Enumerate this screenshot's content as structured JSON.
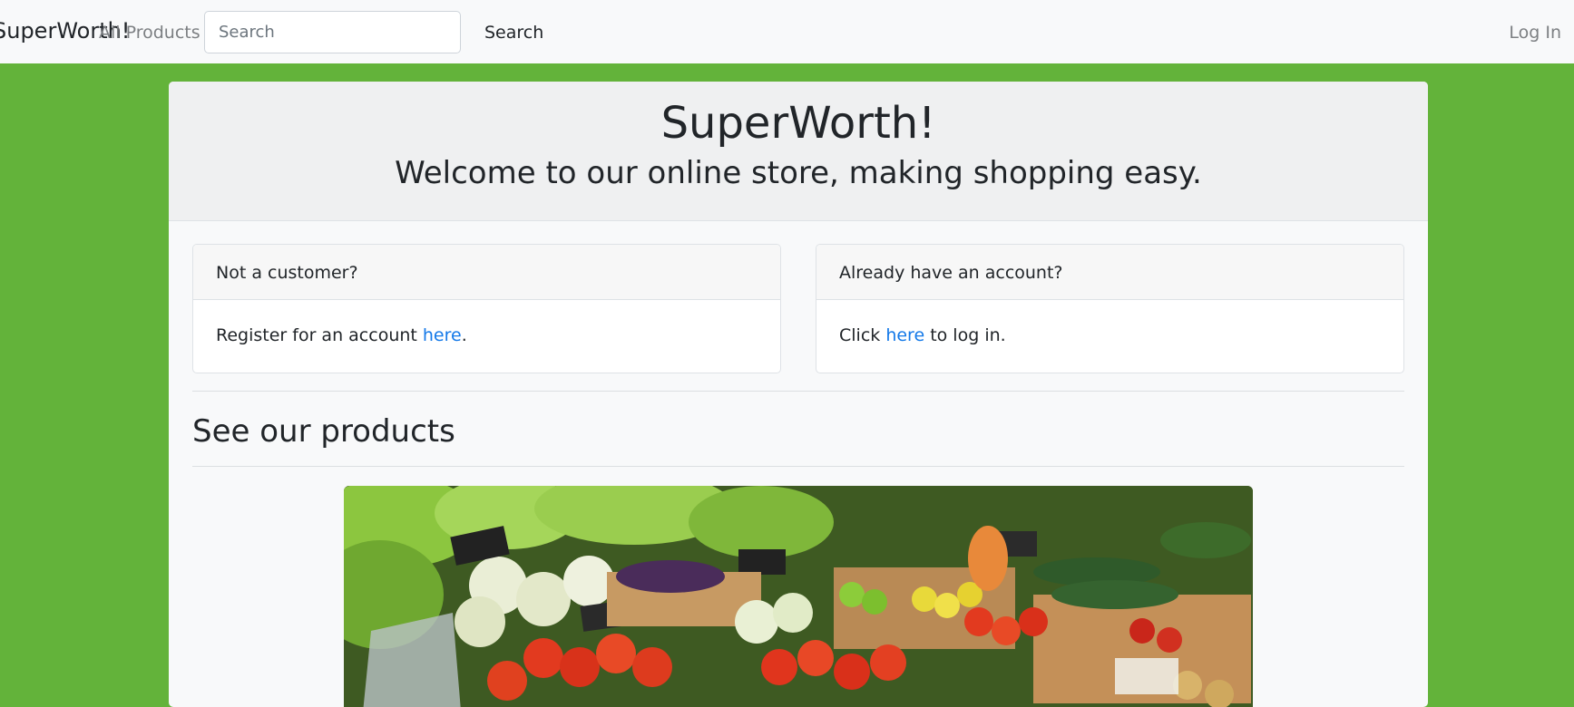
{
  "navbar": {
    "brand": "SuperWorth!",
    "all_products": "All Products",
    "search_placeholder": "Search",
    "search_button": "Search",
    "login": "Log In"
  },
  "jumbotron": {
    "title": "SuperWorth!",
    "subtitle": "Welcome to our online store, making shopping easy."
  },
  "cards": {
    "register": {
      "header": "Not a customer?",
      "text_before": "Register for an account ",
      "link": "here",
      "text_after": "."
    },
    "login": {
      "header": "Already have an account?",
      "text_before": "Click ",
      "link": "here",
      "text_after": " to log in."
    }
  },
  "products": {
    "heading": "See our products"
  },
  "colors": {
    "page_background": "#63b33a",
    "link": "#1479e8"
  }
}
